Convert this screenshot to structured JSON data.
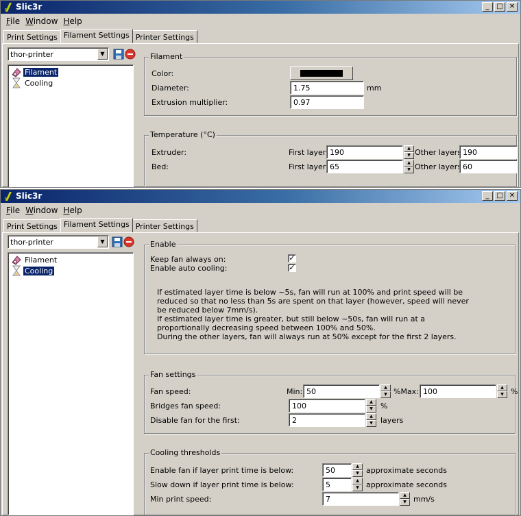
{
  "app": {
    "title": "Slic3r",
    "window_buttons": [
      "_",
      "□",
      "✕"
    ]
  },
  "menus": [
    {
      "label": "File",
      "key": "F"
    },
    {
      "label": "Window",
      "key": "W"
    },
    {
      "label": "Help",
      "key": "H"
    }
  ],
  "tabs": [
    "Print Settings",
    "Filament Settings",
    "Printer Settings"
  ],
  "active_tab": "Filament Settings",
  "preset": {
    "value": "thor-printer",
    "save_icon": "save-icon",
    "delete_icon": "delete-icon"
  },
  "tree": {
    "items": [
      {
        "label": "Filament",
        "icon": "filament-spool-icon"
      },
      {
        "label": "Cooling",
        "icon": "cooling-hourglass-icon"
      }
    ]
  },
  "window1": {
    "selected_page": "Filament",
    "filament": {
      "group": "Filament",
      "color_label": "Color:",
      "color_value": "#000000",
      "diameter_label": "Diameter:",
      "diameter_value": "1.75",
      "diameter_unit": "mm",
      "multiplier_label": "Extrusion multiplier:",
      "multiplier_value": "0.97"
    },
    "temperature": {
      "group": "Temperature (°C)",
      "extruder_label": "Extruder:",
      "bed_label": "Bed:",
      "first_layer_label": "First layer:",
      "other_layers_label": "Other layers:",
      "extruder_first": "190",
      "extruder_other": "190",
      "bed_first": "65",
      "bed_other": "60"
    }
  },
  "window2": {
    "selected_page": "Cooling",
    "enable": {
      "group": "Enable",
      "keep_fan_label": "Keep fan always on:",
      "keep_fan_checked": true,
      "auto_cooling_label": "Enable auto cooling:",
      "auto_cooling_checked": true,
      "description": [
        "If estimated layer time is below ~5s, fan will run at 100% and print speed will be",
        "reduced so that no less than 5s are spent on that layer (however, speed will never",
        "be reduced below 7mm/s).",
        "If estimated layer time is greater, but still below ~50s, fan will run at a",
        "proportionally decreasing speed between 100% and 50%.",
        "During the other layers, fan will always run at 50% except for the first 2 layers."
      ]
    },
    "fan": {
      "group": "Fan settings",
      "fan_speed_label": "Fan speed:",
      "min_label": "Min:",
      "min_value": "50",
      "min_unit_max": "%Max:",
      "max_value": "100",
      "max_unit": "%",
      "bridges_label": "Bridges fan speed:",
      "bridges_value": "100",
      "bridges_unit": "%",
      "disable_label": "Disable fan for the first:",
      "disable_value": "2",
      "disable_unit": "layers"
    },
    "thresholds": {
      "group": "Cooling thresholds",
      "enable_below_label": "Enable fan if layer print time is below:",
      "enable_below_value": "50",
      "enable_below_unit": "approximate seconds",
      "slow_down_label": "Slow down if layer print time is below:",
      "slow_down_value": "5",
      "slow_down_unit": "approximate seconds",
      "min_speed_label": "Min print speed:",
      "min_speed_value": "7",
      "min_speed_unit": "mm/s"
    }
  }
}
